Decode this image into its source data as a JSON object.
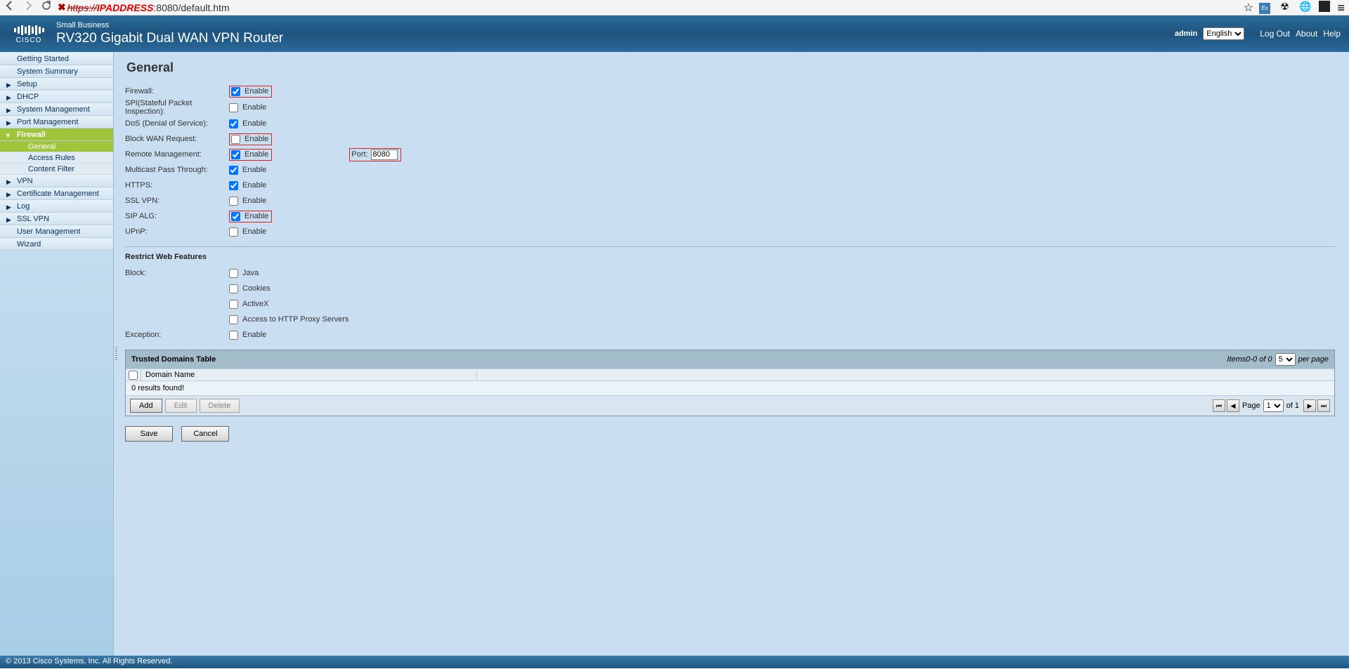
{
  "browser": {
    "url_scheme": "https://",
    "url_ip": "IPADDRESS",
    "url_rest": ":8080/default.htm"
  },
  "header": {
    "vendor": "CISCO",
    "smallBiz": "Small Business",
    "model_line": "RV320  Gigabit Dual WAN VPN Router",
    "user": "admin",
    "language_options": [
      "English"
    ],
    "language_selected": "English",
    "links": {
      "logout": "Log Out",
      "about": "About",
      "help": "Help"
    }
  },
  "sidebar": {
    "items": [
      {
        "label": "Getting Started"
      },
      {
        "label": "System Summary"
      },
      {
        "label": "Setup",
        "expandable": true
      },
      {
        "label": "DHCP",
        "expandable": true
      },
      {
        "label": "System Management",
        "expandable": true
      },
      {
        "label": "Port Management",
        "expandable": true
      },
      {
        "label": "Firewall",
        "expandable": true,
        "expanded": true,
        "active": true,
        "children": [
          {
            "label": "General",
            "active": true
          },
          {
            "label": "Access Rules"
          },
          {
            "label": "Content Filter"
          }
        ]
      },
      {
        "label": "VPN",
        "expandable": true
      },
      {
        "label": "Certificate Management",
        "expandable": true
      },
      {
        "label": "Log",
        "expandable": true
      },
      {
        "label": "SSL VPN",
        "expandable": true
      },
      {
        "label": "User Management"
      },
      {
        "label": "Wizard"
      }
    ]
  },
  "page": {
    "title": "General",
    "settings": {
      "firewall": {
        "label": "Firewall:",
        "text": "Enable",
        "checked": true,
        "hl": true
      },
      "spi": {
        "label": "SPI(Stateful Packet Inspection):",
        "text": "Enable",
        "checked": false
      },
      "dos": {
        "label": "DoS (Denial of Service):",
        "text": "Enable",
        "checked": true
      },
      "blockwan": {
        "label": "Block WAN Request:",
        "text": "Enable",
        "checked": false,
        "hl": true
      },
      "remotemgmt": {
        "label": "Remote Management:",
        "text": "Enable",
        "checked": true,
        "hl": true,
        "port_label": "Port:",
        "port_value": "8080",
        "port_hl": true
      },
      "multicast": {
        "label": "Multicast Pass Through:",
        "text": "Enable",
        "checked": true
      },
      "https": {
        "label": "HTTPS:",
        "text": "Enable",
        "checked": true
      },
      "sslvpn": {
        "label": "SSL VPN:",
        "text": "Enable",
        "checked": false
      },
      "sipalg": {
        "label": "SIP ALG:",
        "text": "Enable",
        "checked": true,
        "hl": true
      },
      "upnp": {
        "label": "UPnP:",
        "text": "Enable",
        "checked": false
      }
    },
    "restrict": {
      "heading": "Restrict Web Features",
      "block_label": "Block:",
      "java": {
        "text": "Java",
        "checked": false
      },
      "cookies": {
        "text": "Cookies",
        "checked": false
      },
      "activex": {
        "text": "ActiveX",
        "checked": false
      },
      "proxy": {
        "text": "Access to HTTP Proxy Servers",
        "checked": false
      },
      "exception_label": "Exception:",
      "exception": {
        "text": "Enable",
        "checked": false
      }
    },
    "trusted": {
      "title": "Trusted Domains Table",
      "items_text": "Items0-0 of 0",
      "per_page_options": [
        "5"
      ],
      "per_page_selected": "5",
      "per_page_label": "per page",
      "col_domain": "Domain Name",
      "empty": "0 results found!",
      "buttons": {
        "add": "Add",
        "edit": "Edit",
        "delete": "Delete"
      },
      "pager": {
        "page_label": "Page",
        "page_options": [
          "1"
        ],
        "page_selected": "1",
        "of_label": "of 1"
      }
    },
    "actions": {
      "save": "Save",
      "cancel": "Cancel"
    }
  },
  "footer": {
    "copyright": "© 2013 Cisco Systems, Inc. All Rights Reserved."
  }
}
